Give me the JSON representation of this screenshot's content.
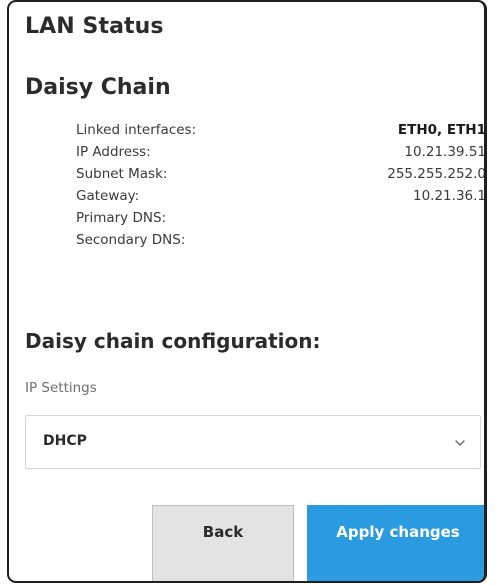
{
  "lan_status": {
    "title": "LAN Status"
  },
  "daisy_chain": {
    "title": "Daisy Chain",
    "rows": [
      {
        "label": "Linked interfaces:",
        "value": "ETH0, ETH1"
      },
      {
        "label": "IP Address:",
        "value": "10.21.39.51"
      },
      {
        "label": "Subnet Mask:",
        "value": "255.255.252.0"
      },
      {
        "label": "Gateway:",
        "value": "10.21.36.1"
      },
      {
        "label": "Primary DNS:",
        "value": ""
      },
      {
        "label": "Secondary DNS:",
        "value": ""
      }
    ]
  },
  "config": {
    "title": "Daisy chain configuration:",
    "ip_settings_label": "IP Settings",
    "ip_settings_value": "DHCP"
  },
  "actions": {
    "back_label": "Back",
    "apply_label": "Apply changes"
  },
  "colors": {
    "accent": "#2a9be0",
    "secondary_button": "#e3e3e3"
  },
  "icons": {
    "select_chevron": "chevron-down-icon"
  }
}
